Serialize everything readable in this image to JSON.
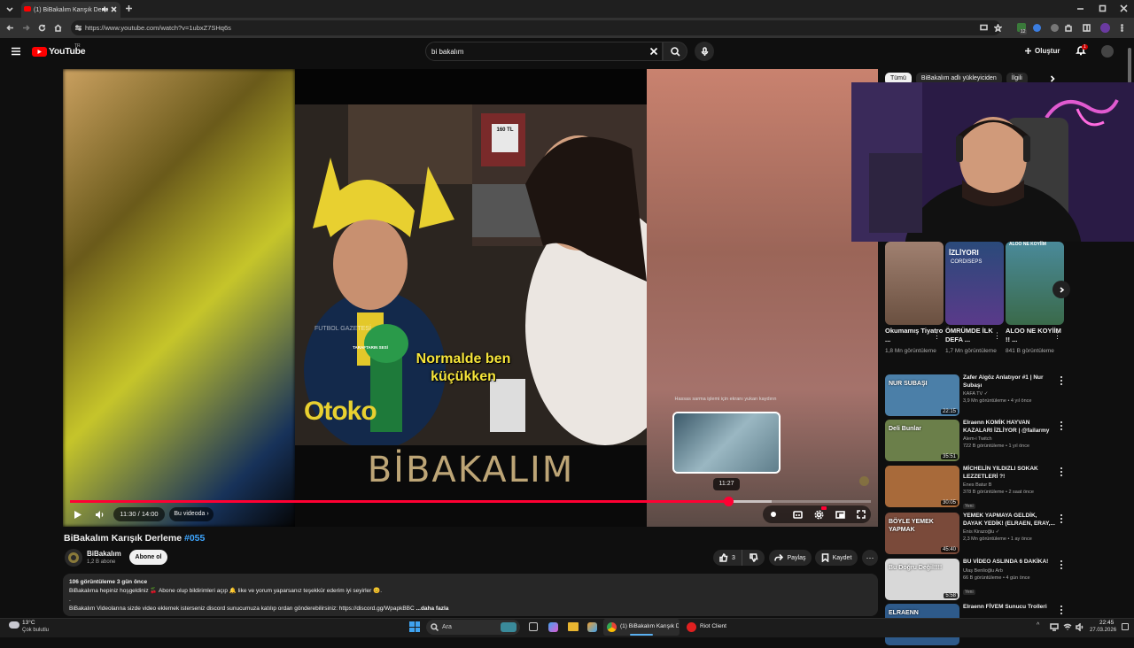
{
  "browser": {
    "tab_title": "(1) BiBakalım Karışık Derle",
    "url": "https://www.youtube.com/watch?v=1ubxZ7SHq6s",
    "notification_count": "12"
  },
  "yt": {
    "logo_text": "YouTube",
    "logo_region": "TR",
    "search_value": "bi bakalım",
    "create_label": "Oluştur",
    "notif_count": "1"
  },
  "player": {
    "subtitle": "Normalde ben küçükken",
    "watermark": "BİBAKALIM",
    "mic_brand": "FUTBOL GAZETESİ",
    "mic_logo": "TARAFTARIN SESİ",
    "sign_text": "Otoko",
    "store_sign": "160 TL",
    "seek_hint": "Hassas sarma işlemi için ekranı yukarı kaydırın",
    "preview_time": "11:27",
    "time_display": "11:30 / 14:00",
    "chapter_label": "Bu videoda",
    "progress": 0.8214,
    "loaded": 0.876
  },
  "video": {
    "title": "BiBakalım Karışık Derleme",
    "tag": "#055",
    "channel_name": "BiBakalım",
    "channel_subs": "1,2 B abone",
    "subscribe_label": "Abone ol",
    "likes": "3",
    "share_label": "Paylaş",
    "save_label": "Kaydet"
  },
  "description": {
    "meta": "106 görüntüleme  3 gün önce",
    "line1": "BiBakalıma hepiniz hoşgeldiniz 🍒 Abone olup bildirimleri açıp 🔔 like ve yorum yaparsanız teşekkür ederim iyi seyirler 😊.",
    "line2": ".",
    "line3": "BiBakalım Videolarına sizde video eklemek isterseniz discord sunucumuza katılıp ordan gönderebilirsiniz: https://discord.gg/WpapkBBC",
    "more": "...daha fazla"
  },
  "chips": [
    "Tümü",
    "BiBakalım adlı yükleyiciden",
    "İlgili"
  ],
  "shorts": [
    {
      "title": "Okumamış Tiyatro ...",
      "views": "1,8 Mn görüntüleme",
      "color": "#8c6a52"
    },
    {
      "title": "ÖMRÜMDE İLK DEFA ...",
      "views": "1,7 Mn görüntüleme",
      "color": "#3b5d9a",
      "overlay": "İZLİYORI",
      "overlay2": "CORDISEPS"
    },
    {
      "title": "ALOO NE KOYİİM !! ...",
      "views": "841 B görüntüleme",
      "color": "#5e8f6b",
      "overlay": "ALOO NE KOYİİM"
    }
  ],
  "recommendations": [
    {
      "title": "Zafer Algöz Anlatıyor #1 | Nur Subaşı",
      "channel": "KAFA TV",
      "verified": true,
      "meta": "3,9 Mn görüntüleme • 4 yıl önce",
      "duration": "22:15",
      "color": "#4b7fa8",
      "badge": "",
      "overlay": "NUR SUBAŞI"
    },
    {
      "title": "Elraenn KOMİK HAYVAN KAZALARI İZLİYOR | @failarmy",
      "channel": "Alem-i Twitch",
      "verified": false,
      "meta": "722 B görüntüleme • 1 yıl önce",
      "duration": "35:51",
      "color": "#6b7f4a",
      "badge": "",
      "overlay": "Deli Bunlar"
    },
    {
      "title": "MİCHELİN YILDIZLI SOKAK LEZZETLERİ ?!",
      "channel": "Enes Batur B",
      "verified": false,
      "meta": "378 B görüntüleme • 2 saat önce",
      "duration": "30:05",
      "color": "#a86a3a",
      "badge": "Yeni",
      "overlay": ""
    },
    {
      "title": "YEMEK YAPMAYA GELDİK, DAYAK YEDİK! (ELRAEN, ERAY,...",
      "channel": "Enis Kirazoğlu",
      "verified": true,
      "meta": "2,3 Mn görüntüleme • 1 ay önce",
      "duration": "45:40",
      "color": "#7a4a3a",
      "badge": "",
      "overlay": "BÖYLE YEMEK YAPMAK"
    },
    {
      "title": "BU VİDEO ASLINDA 6 DAKİKA!",
      "channel": "Ulaş Benlioğlu Arb",
      "verified": false,
      "meta": "66 B görüntüleme • 4 gün önce",
      "duration": "5:58",
      "color": "#d8d8d8",
      "badge": "Yeni",
      "overlay": "Bu Doğru Değil!!!!"
    },
    {
      "title": "Elraenn FİVEM Sunucu Trolleri",
      "channel": "",
      "verified": false,
      "meta": "",
      "duration": "",
      "color": "#2e5a8a",
      "badge": "",
      "overlay": "ELRAENN"
    }
  ],
  "taskbar": {
    "temp": "13°C",
    "weather": "Çok bulutlu",
    "search_label": "Ara",
    "chrome_label": "(1) BiBakalım Karışık Der",
    "riot_label": "Riot Client",
    "time": "22:45",
    "date": "27.03.2026"
  },
  "colors": {
    "accent": "#ff0033",
    "link": "#3ea6ff",
    "background": "#0f0f0f"
  }
}
